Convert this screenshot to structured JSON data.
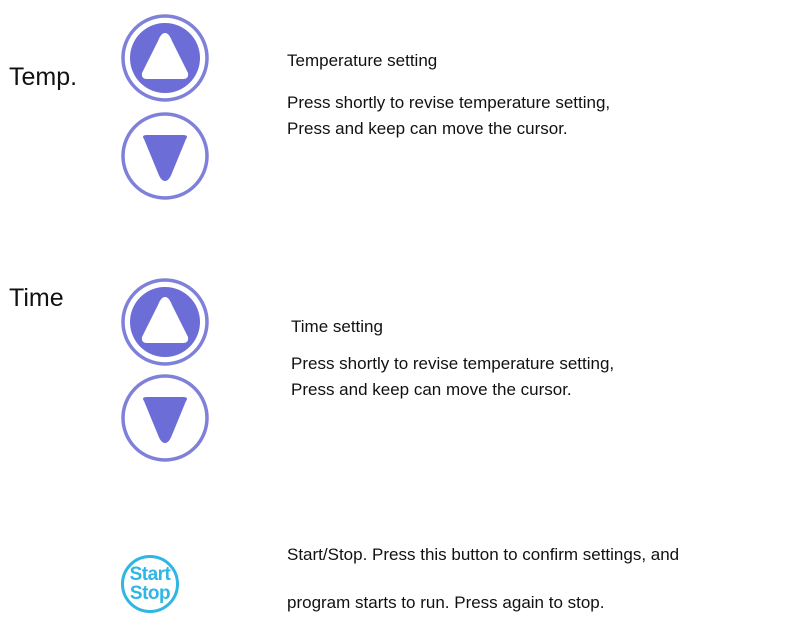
{
  "colors": {
    "arrow_button_fill": "#6c6dd6",
    "arrow_button_ring": "#7f80d9",
    "start_stop_accent": "#2fb6e4",
    "text": "#111111"
  },
  "temperature": {
    "label": "Temp.",
    "title": "Temperature setting",
    "line1": "Press shortly to revise temperature setting,",
    "line2": "Press and keep can move the cursor.",
    "up_icon": "arrow-up-circle-icon",
    "down_icon": "arrow-down-circle-icon"
  },
  "time": {
    "label": "Time",
    "title": "Time setting",
    "line1": "Press shortly to revise temperature setting,",
    "line2": "Press and keep can move the cursor.",
    "up_icon": "arrow-up-circle-icon",
    "down_icon": "arrow-down-circle-icon"
  },
  "start_stop": {
    "button_line1": "Start",
    "button_line2": "Stop",
    "line1": "Start/Stop. Press this button to confirm settings, and",
    "line2": "program starts to run. Press again to stop."
  }
}
